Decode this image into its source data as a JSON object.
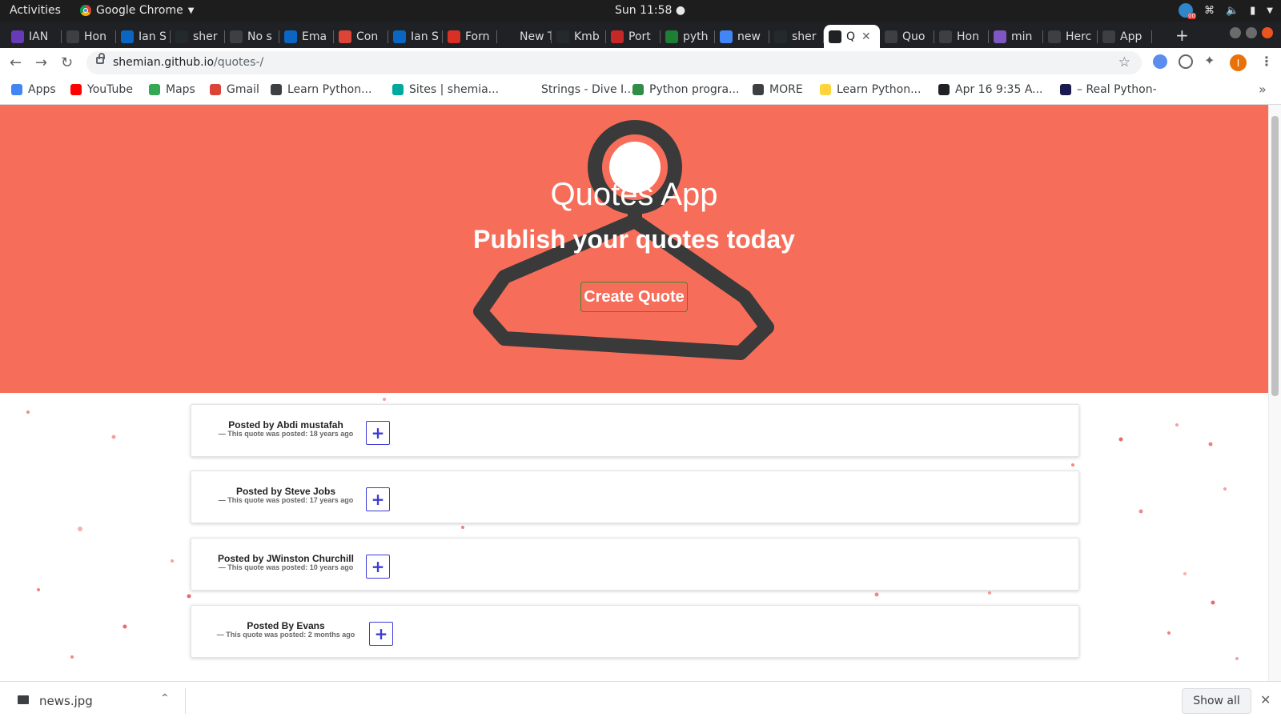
{
  "system": {
    "activities": "Activities",
    "app_name": "Google Chrome",
    "clock": "Sun 11:58 ●",
    "tray_badge": "00"
  },
  "tabs": [
    {
      "label": "IAN",
      "color": "#673ab7"
    },
    {
      "label": "Hon",
      "color": "#3c4043"
    },
    {
      "label": "Ian S",
      "color": "#0a66c2"
    },
    {
      "label": "sher",
      "color": "#24292e"
    },
    {
      "label": "No s",
      "color": "#3c4043"
    },
    {
      "label": "Ema",
      "color": "#0a66c2"
    },
    {
      "label": "Con",
      "color": "#db4437"
    },
    {
      "label": "Ian S",
      "color": "#0a66c2"
    },
    {
      "label": "Forn",
      "color": "#d93025"
    },
    {
      "label": "New Ta",
      "color": "#202124"
    },
    {
      "label": "Kmb",
      "color": "#24292e"
    },
    {
      "label": "Port",
      "color": "#c62828"
    },
    {
      "label": "pyth",
      "color": "#1e7e34"
    },
    {
      "label": "new",
      "color": "#4285f4"
    },
    {
      "label": "sher",
      "color": "#24292e"
    },
    {
      "label": "Q",
      "color": "#202124"
    },
    {
      "label": "Quo",
      "color": "#3c4043"
    },
    {
      "label": "Hon",
      "color": "#3c4043"
    },
    {
      "label": "min",
      "color": "#7e57c2"
    },
    {
      "label": "Herc",
      "color": "#3c4043"
    },
    {
      "label": "App",
      "color": "#3c4043"
    }
  ],
  "address": {
    "host": "shemian.github.io",
    "path": "/quotes-/"
  },
  "profile_initial": "I",
  "bookmarks": [
    {
      "label": "Apps",
      "color": "#4285f4"
    },
    {
      "label": "YouTube",
      "color": "#ff0000"
    },
    {
      "label": "Maps",
      "color": "#34a853"
    },
    {
      "label": "Gmail",
      "color": "#db4437"
    },
    {
      "label": "Learn Python...",
      "color": "#3c4043"
    },
    {
      "label": "Sites | shemia...",
      "color": "#00a99d"
    },
    {
      "label": "Strings - Dive I...",
      "color": "#ffffff"
    },
    {
      "label": "Python progra...",
      "color": "#2f8d46"
    },
    {
      "label": "MORE",
      "color": "#3c4043"
    },
    {
      "label": "Learn Python...",
      "color": "#ffd43b"
    },
    {
      "label": "Apr 16 9:35 A...",
      "color": "#202124"
    },
    {
      "label": "– Real Python-",
      "color": "#1a1a4e"
    }
  ],
  "page": {
    "title": "Quotes App",
    "subtitle": "Publish your quotes today",
    "cta": "Create Quote",
    "hero_color": "#f66e5a",
    "quotes": [
      {
        "author": "Posted by Abdi mustafah",
        "meta": "— This quote was posted: 18 years ago",
        "action": "+"
      },
      {
        "author": "Posted by Steve Jobs",
        "meta": "— This quote was posted: 17 years ago",
        "action": "+"
      },
      {
        "author": "Posted by JWinston Churchill",
        "meta": "— This quote was posted: 10 years ago",
        "action": "+"
      },
      {
        "author": "Posted By Evans",
        "meta": "— This quote was posted: 2 months ago",
        "action": "+"
      }
    ]
  },
  "downloads": {
    "file": "news.jpg",
    "show_all": "Show all"
  }
}
